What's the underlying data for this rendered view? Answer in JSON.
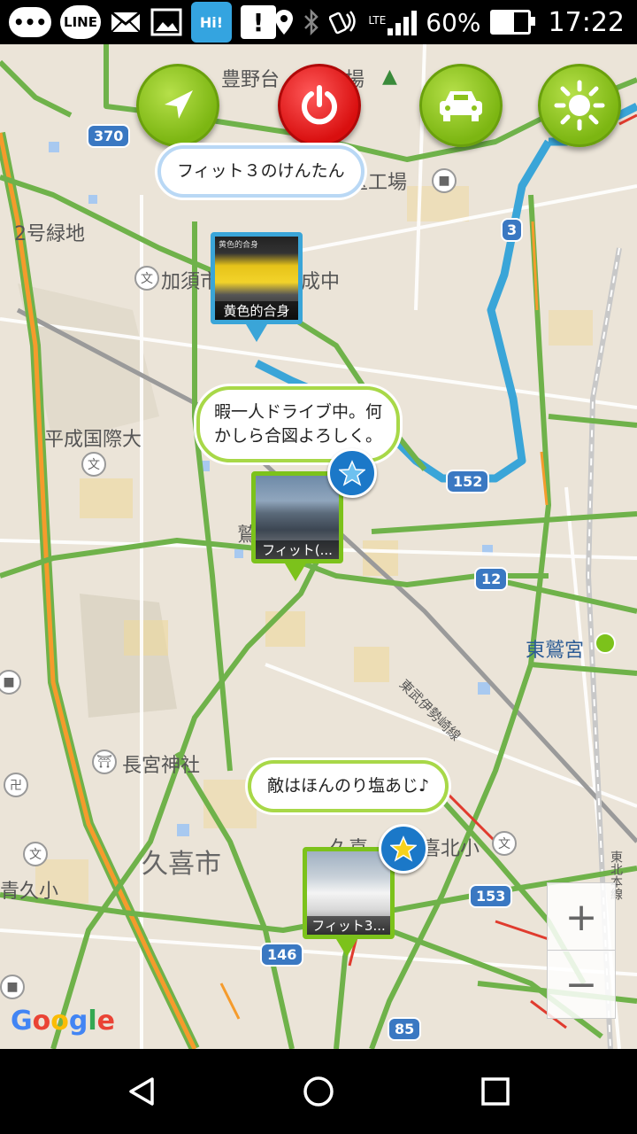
{
  "status_bar": {
    "line_label": "LINE",
    "hi_label": "Hi!",
    "network": "LTE",
    "battery": "60%",
    "battery_level": 0.6,
    "time": "17:22",
    "icons": [
      "chat-bubble-icon",
      "line-icon",
      "mail-icon",
      "image-icon",
      "hi-app-icon",
      "alert-icon",
      "location-icon",
      "bluetooth-icon",
      "nfc-icon",
      "signal-icon",
      "battery-icon"
    ]
  },
  "map": {
    "labels": {
      "toyono": "豊野台",
      "kojo_top": "広場",
      "saitama_kojo": "埼玉工場",
      "ryokuchi": "2号緑地",
      "kazo": "加須市",
      "seichu": "成中",
      "heisei": "平成国際大",
      "washi": "鷲",
      "higashi_washinomiya": "東鷲宮",
      "tobu_line": "東武伊勢崎線",
      "nagamiya": "長宮神社",
      "kuki_city": "久喜市",
      "kuki": "久喜",
      "kuki_kita": "喜北小",
      "ao_kuki": "青久小",
      "tohoku_line": "東北本線"
    },
    "shields": [
      "370",
      "3",
      "152",
      "12",
      "153",
      "146",
      "85"
    ],
    "attribution": "Google"
  },
  "toolbar": {
    "buttons": [
      {
        "name": "navigate",
        "icon": "navigation-arrow-icon",
        "color": "#8cc21b"
      },
      {
        "name": "power",
        "icon": "power-icon",
        "color": "#e01818"
      },
      {
        "name": "car",
        "icon": "car-icon",
        "color": "#8cc21b"
      },
      {
        "name": "brightness",
        "icon": "sun-icon",
        "color": "#8cc21b"
      }
    ]
  },
  "posts": [
    {
      "message": "フィット３のけんたん",
      "caption": "黄色的合身",
      "photo_header": "黄色的合身"
    },
    {
      "message_line1": "暇一人ドライブ中。何",
      "message_line2": "かしら合図よろしく。",
      "caption": "フィット(..."
    },
    {
      "message": "敵はほんのり塩あじ♪",
      "caption": "フィット3..."
    }
  ],
  "zoom": {
    "in": "+",
    "out": "−"
  },
  "nav": {
    "back": "back-icon",
    "home": "home-icon",
    "recent": "recent-apps-icon"
  }
}
